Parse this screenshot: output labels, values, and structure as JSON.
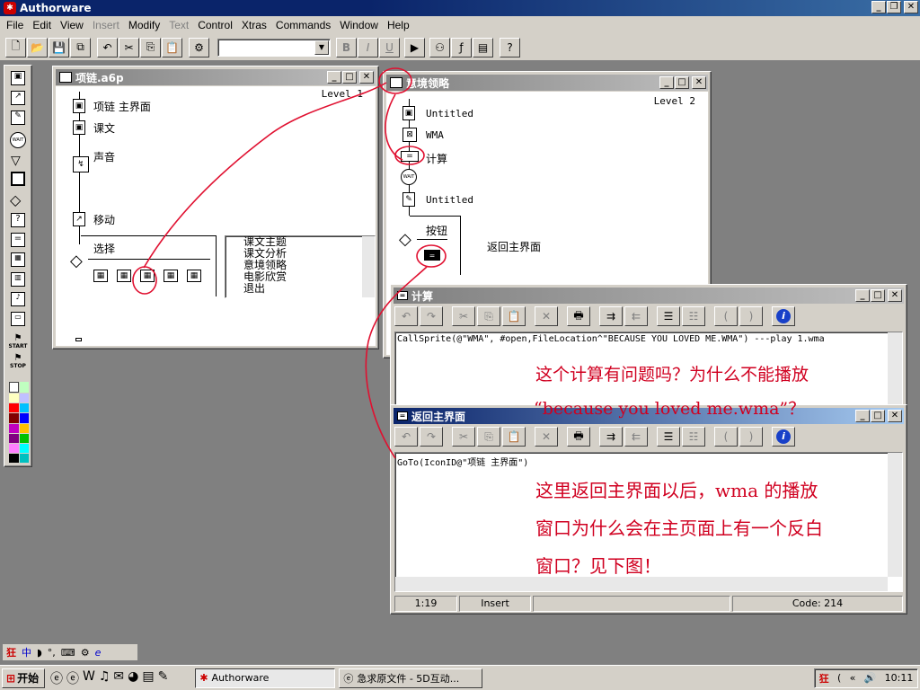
{
  "app": {
    "title": "Authorware"
  },
  "menu": [
    "File",
    "Edit",
    "View",
    "Insert",
    "Modify",
    "Text",
    "Control",
    "Xtras",
    "Commands",
    "Window",
    "Help"
  ],
  "win1": {
    "title": "项链.a6p",
    "level": "Level 1",
    "icons": [
      "项链 主界面",
      "课文",
      "声音",
      "移动",
      "选择"
    ],
    "list": [
      "课文主题",
      "课文分析",
      "意境领略",
      "电影欣赏",
      "退出"
    ]
  },
  "win2": {
    "title": "意境领略",
    "level": "Level 2",
    "icons": [
      "Untitled",
      "WMA",
      "计算",
      "Untitled",
      "按钮",
      "返回主界面"
    ]
  },
  "win3": {
    "title": "计算",
    "code": "CallSprite(@\"WMA\", #open,FileLocation^\"BECAUSE YOU LOVED ME.WMA\") ---play 1.wma",
    "note1": "这个计算有问题吗？为什么不能播放",
    "note2": "“because you loved me.wma”？"
  },
  "win4": {
    "title": "返回主界面",
    "code": "GoTo(IconID@\"项链 主界面\")",
    "note1": "这里返回主界面以后，wma 的播放",
    "note2": "窗口为什么会在主页面上有一个反白",
    "note3": "窗口？见下图！",
    "status": {
      "pos": "1:19",
      "mode": "Insert",
      "code": "Code: 214"
    }
  },
  "palette": {
    "start": "START",
    "stop": "STOP"
  },
  "taskbar": {
    "start": "开始",
    "tasks": [
      "Authorware",
      "急求原文件 - 5D互动..."
    ],
    "time": "10:11"
  },
  "colors": {
    "accent": "#0a246a",
    "annotation": "#d00020"
  }
}
